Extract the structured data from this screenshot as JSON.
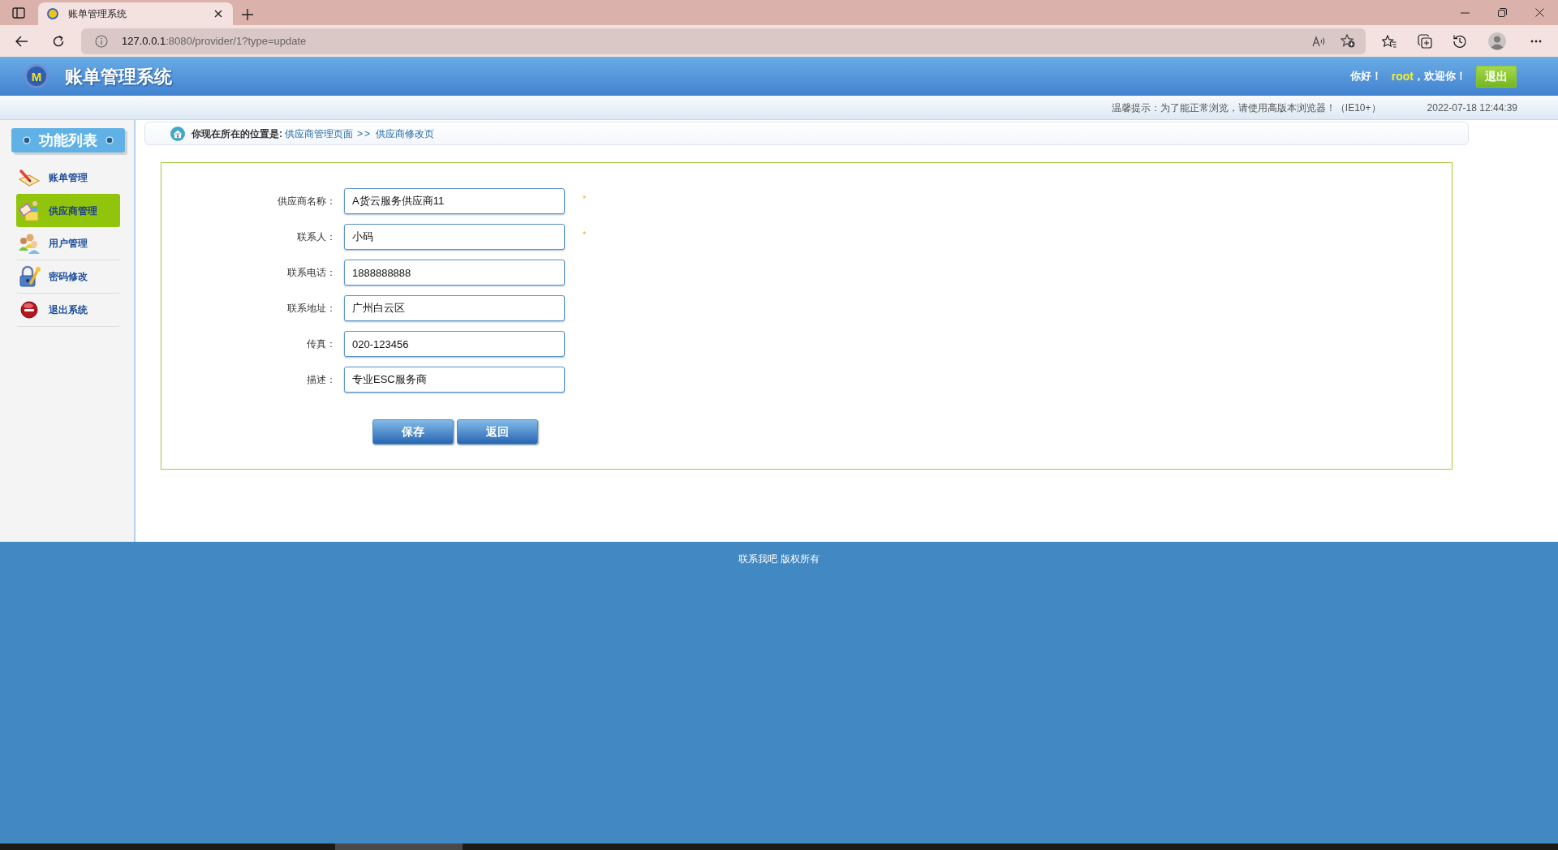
{
  "browser": {
    "tab": {
      "title": "账单管理系统"
    },
    "url": {
      "host": "127.0.0.1",
      "rest": ":8080/provider/1?type=update"
    }
  },
  "header": {
    "logo_mark": "M",
    "title": "账单管理系统",
    "greeting": "你好！",
    "user": "root",
    "welcome": "，欢迎你！",
    "logout": "退出"
  },
  "notice": {
    "tip": "温馨提示：为了能正常浏览，请使用高版本浏览器！（IE10+）",
    "time": "2022-07-18 12:44:39"
  },
  "sidebar": {
    "title": "功能列表",
    "items": [
      {
        "label": "账单管理",
        "selected": false
      },
      {
        "label": "供应商管理",
        "selected": true
      },
      {
        "label": "用户管理",
        "selected": false
      },
      {
        "label": "密码修改",
        "selected": false
      },
      {
        "label": "退出系统",
        "selected": false
      }
    ]
  },
  "breadcrumb": {
    "prefix": "你现在所在的位置是:",
    "path": [
      "供应商管理页面",
      "供应商修改页"
    ],
    "separator": ">>"
  },
  "form": {
    "fields": [
      {
        "label": "供应商名称：",
        "value": "A货云服务供应商11",
        "required": true
      },
      {
        "label": "联系人：",
        "value": "小码",
        "required": true
      },
      {
        "label": "联系电话：",
        "value": "1888888888",
        "required": false
      },
      {
        "label": "联系地址：",
        "value": "广州白云区",
        "required": false
      },
      {
        "label": "传真：",
        "value": "020-123456",
        "required": false
      },
      {
        "label": "描述：",
        "value": "专业ESC服务商",
        "required": false
      }
    ],
    "required_mark": "*",
    "buttons": [
      "保存",
      "返回"
    ]
  },
  "footer": {
    "text": "联系我吧 版权所有"
  }
}
